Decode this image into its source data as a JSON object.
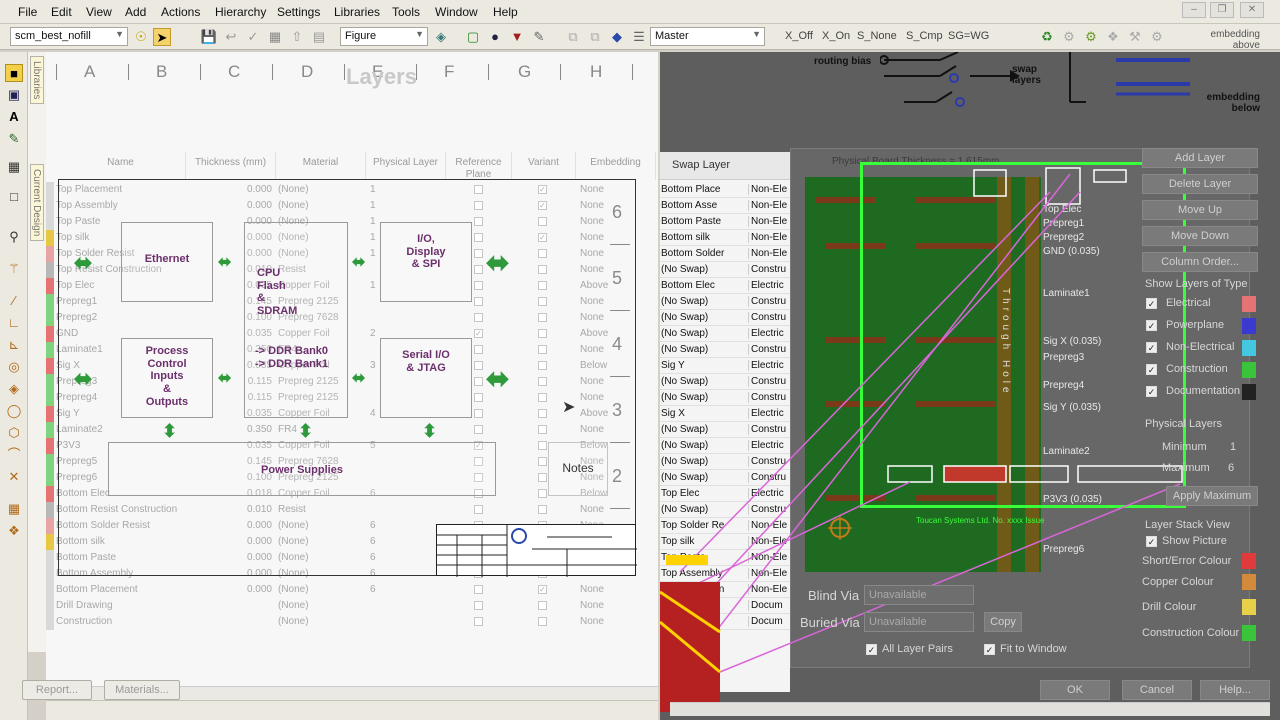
{
  "menu": {
    "items": [
      "File",
      "Edit",
      "View",
      "Add",
      "Actions",
      "Hierarchy",
      "Settings",
      "Libraries",
      "Tools",
      "Window",
      "Help"
    ]
  },
  "toolbar": {
    "style_combo": "scm_best_nofill",
    "mode_combo": "Figure",
    "variant_combo": "Master",
    "switches": [
      "X_Off",
      "X_On",
      "S_None",
      "S_Cmp",
      "SG=WG"
    ],
    "embedding_above": "embedding above"
  },
  "side_tabs": [
    "Libraries",
    "Current Design"
  ],
  "design": {
    "column_letters": [
      "A",
      "B",
      "C",
      "D",
      "E",
      "F",
      "G",
      "H"
    ],
    "overlay_title": "Layers",
    "row_digits": [
      "6",
      "5",
      "4",
      "3",
      "2",
      "1"
    ],
    "table": {
      "headers": [
        "Name",
        "Thickness (mm)",
        "Material",
        "Physical Layer",
        "Reference Plane",
        "Variant",
        "Embedding"
      ],
      "rows": [
        {
          "name": "Top Placement",
          "thk": "0.000",
          "mat": "(None)",
          "phys": "1",
          "ref": false,
          "var": true,
          "emb": "None",
          "color": "#d9d9d9"
        },
        {
          "name": "Top Assembly",
          "thk": "0.000",
          "mat": "(None)",
          "phys": "1",
          "ref": false,
          "var": true,
          "emb": "None",
          "color": "#d9d9d9"
        },
        {
          "name": "Top Paste",
          "thk": "0.000",
          "mat": "(None)",
          "phys": "1",
          "ref": false,
          "var": false,
          "emb": "None",
          "color": "#d9d9d9"
        },
        {
          "name": "Top silk",
          "thk": "0.000",
          "mat": "(None)",
          "phys": "1",
          "ref": false,
          "var": true,
          "emb": "None",
          "color": "#e6c845"
        },
        {
          "name": "Top Solder Resist",
          "thk": "0.000",
          "mat": "(None)",
          "phys": "1",
          "ref": false,
          "var": false,
          "emb": "None",
          "color": "#e8a3a3"
        },
        {
          "name": "Top Resist Construction",
          "thk": "0.010",
          "mat": "Resist",
          "phys": "",
          "ref": false,
          "var": false,
          "emb": "None",
          "color": "#b7b7b7"
        },
        {
          "name": "Top Elec",
          "thk": "0.035",
          "mat": "Copper Foil",
          "phys": "1",
          "ref": false,
          "var": false,
          "emb": "Above",
          "color": "#e57373"
        },
        {
          "name": "Prepreg1",
          "thk": "0.145",
          "mat": "Prepreg 2125",
          "phys": "",
          "ref": false,
          "var": false,
          "emb": "None",
          "color": "#7fd37f"
        },
        {
          "name": "Prepreg2",
          "thk": "0.100",
          "mat": "Prepreg 7628",
          "phys": "",
          "ref": false,
          "var": false,
          "emb": "None",
          "color": "#7fd37f"
        },
        {
          "name": "GND",
          "thk": "0.035",
          "mat": "Copper Foil",
          "phys": "2",
          "ref": true,
          "var": false,
          "emb": "Above",
          "color": "#e57373"
        },
        {
          "name": "Laminate1",
          "thk": "0.350",
          "mat": "FR4",
          "phys": "",
          "ref": false,
          "var": false,
          "emb": "None",
          "color": "#7fd37f"
        },
        {
          "name": "Sig X",
          "thk": "0.035",
          "mat": "Copper Foil",
          "phys": "3",
          "ref": false,
          "var": false,
          "emb": "Below",
          "color": "#e57373"
        },
        {
          "name": "Prepreg3",
          "thk": "0.115",
          "mat": "Prepreg 2125",
          "phys": "",
          "ref": false,
          "var": false,
          "emb": "None",
          "color": "#7fd37f"
        },
        {
          "name": "Prepreg4",
          "thk": "0.115",
          "mat": "Prepreg 2125",
          "phys": "",
          "ref": false,
          "var": false,
          "emb": "None",
          "color": "#7fd37f"
        },
        {
          "name": "Sig Y",
          "thk": "0.035",
          "mat": "Copper Foil",
          "phys": "4",
          "ref": false,
          "var": false,
          "emb": "Above",
          "color": "#e57373"
        },
        {
          "name": "Laminate2",
          "thk": "0.350",
          "mat": "FR4",
          "phys": "",
          "ref": false,
          "var": false,
          "emb": "None",
          "color": "#7fd37f"
        },
        {
          "name": "P3V3",
          "thk": "0.035",
          "mat": "Copper Foil",
          "phys": "5",
          "ref": true,
          "var": false,
          "emb": "Below",
          "color": "#e57373"
        },
        {
          "name": "Prepreg5",
          "thk": "0.145",
          "mat": "Prepreg 7628",
          "phys": "",
          "ref": false,
          "var": false,
          "emb": "None",
          "color": "#7fd37f"
        },
        {
          "name": "Prepreg6",
          "thk": "0.100",
          "mat": "Prepreg 2125",
          "phys": "",
          "ref": false,
          "var": false,
          "emb": "None",
          "color": "#7fd37f"
        },
        {
          "name": "Bottom Elec",
          "thk": "0.018",
          "mat": "Copper Foil",
          "phys": "6",
          "ref": false,
          "var": false,
          "emb": "Below",
          "color": "#e57373"
        },
        {
          "name": "Bottom Resist Construction",
          "thk": "0.010",
          "mat": "Resist",
          "phys": "",
          "ref": false,
          "var": false,
          "emb": "None",
          "color": "#b7b7b7"
        },
        {
          "name": "Bottom Solder Resist",
          "thk": "0.000",
          "mat": "(None)",
          "phys": "6",
          "ref": false,
          "var": false,
          "emb": "None",
          "color": "#e8a3a3"
        },
        {
          "name": "Bottom silk",
          "thk": "0.000",
          "mat": "(None)",
          "phys": "6",
          "ref": false,
          "var": false,
          "emb": "None",
          "color": "#e6c845"
        },
        {
          "name": "Bottom Paste",
          "thk": "0.000",
          "mat": "(None)",
          "phys": "6",
          "ref": false,
          "var": false,
          "emb": "None",
          "color": "#d9d9d9"
        },
        {
          "name": "Bottom Assembly",
          "thk": "0.000",
          "mat": "(None)",
          "phys": "6",
          "ref": false,
          "var": false,
          "emb": "None",
          "color": "#d9d9d9"
        },
        {
          "name": "Bottom Placement",
          "thk": "0.000",
          "mat": "(None)",
          "phys": "6",
          "ref": false,
          "var": true,
          "emb": "None",
          "color": "#d9d9d9"
        },
        {
          "name": "Drill Drawing",
          "thk": "",
          "mat": "(None)",
          "phys": "",
          "ref": false,
          "var": false,
          "emb": "None",
          "color": "#d9d9d9"
        },
        {
          "name": "Construction",
          "thk": "",
          "mat": "(None)",
          "phys": "",
          "ref": false,
          "var": false,
          "emb": "None",
          "color": "#d9d9d9"
        }
      ]
    },
    "blocks": {
      "ethernet": "Ethernet",
      "cpu": [
        "CPU",
        "Flash",
        "&",
        "SDRAM"
      ],
      "ddr": [
        "-> DDR Bank0",
        "-> DDR Bank1"
      ],
      "io_display": [
        "I/O,",
        "Display",
        "& SPI"
      ],
      "process_control": [
        "Process",
        "Control",
        "Inputs",
        "&",
        "Outputs"
      ],
      "serial_io": [
        "Serial I/O",
        "& JTAG"
      ],
      "power": "Power Supplies",
      "notes": "Notes"
    },
    "buttons": {
      "report": "Report...",
      "materials": "Materials..."
    }
  },
  "right": {
    "legend": {
      "routing_bias": "routing bias",
      "swap_layers": "swap layers",
      "embedding_below": "embedding below"
    },
    "swap_header": "Swap Layer",
    "swap_rows": [
      [
        "Bottom Place",
        "Non-Ele"
      ],
      [
        "Bottom Asse",
        "Non-Ele"
      ],
      [
        "Bottom Paste",
        "Non-Ele"
      ],
      [
        "Bottom silk",
        "Non-Ele"
      ],
      [
        "Bottom Solder",
        "Non-Ele"
      ],
      [
        "(No Swap)",
        "Constru"
      ],
      [
        "Bottom Elec",
        "Electric"
      ],
      [
        "(No Swap)",
        "Constru"
      ],
      [
        "(No Swap)",
        "Constru"
      ],
      [
        "(No Swap)",
        "Electric"
      ],
      [
        "(No Swap)",
        "Constru"
      ],
      [
        "Sig Y",
        "Electric"
      ],
      [
        "(No Swap)",
        "Constru"
      ],
      [
        "(No Swap)",
        "Constru"
      ],
      [
        "Sig X",
        "Electric"
      ],
      [
        "(No Swap)",
        "Constru"
      ],
      [
        "(No Swap)",
        "Electric"
      ],
      [
        "(No Swap)",
        "Constru"
      ],
      [
        "(No Swap)",
        "Constru"
      ],
      [
        "Top Elec",
        "Electric"
      ],
      [
        "(No Swap)",
        "Constru"
      ],
      [
        "Top Solder Re",
        "Non-Ele"
      ],
      [
        "Top silk",
        "Non-Ele"
      ],
      [
        "Top Paste",
        "Non-Ele"
      ],
      [
        "Top Assembly",
        "Non-Ele"
      ],
      [
        "Top Placemen",
        "Non-Ele"
      ],
      [
        "(None)",
        "Docum"
      ],
      [
        "(None)",
        "Docum"
      ]
    ],
    "stack_labels": [
      "Top Elec",
      "Prepreg1",
      "Prepreg2",
      "GND (0.035)",
      "Laminate1",
      "Sig X (0.035)",
      "Prepreg3",
      "Prepreg4",
      "Sig Y (0.035)",
      "Laminate2",
      "P3V3 (0.035)",
      "Prepreg6"
    ],
    "board_thickness_label": "Physical Board Thickness = 1.615mm",
    "through_hole": "Through Hole",
    "footer_caption": "Toucan Systems Ltd. No. xxxx Issue",
    "buttons": [
      "Add Layer",
      "Delete Layer",
      "Move Up",
      "Move Down",
      "Column Order..."
    ],
    "show_layers_title": "Show Layers of Type",
    "show_layers": [
      {
        "label": "Electrical",
        "checked": true,
        "color": "#e57373"
      },
      {
        "label": "Powerplane",
        "checked": true,
        "color": "#3a3ad0"
      },
      {
        "label": "Non-Electrical",
        "checked": true,
        "color": "#44c8e0"
      },
      {
        "label": "Construction",
        "checked": true,
        "color": "#39c43c"
      },
      {
        "label": "Documentation",
        "checked": true,
        "color": "#222222"
      }
    ],
    "physical_layers": {
      "title": "Physical Layers",
      "minimum_label": "Minimum",
      "minimum": "1",
      "maximum_label": "Maximum",
      "maximum": "6",
      "apply": "Apply Maximum"
    },
    "layer_stack_view": {
      "title": "Layer Stack View",
      "show_picture": "Show Picture"
    },
    "colour_rows": [
      {
        "label": "Short/Error Colour",
        "color": "#e03a3a"
      },
      {
        "label": "Copper Colour",
        "color": "#d38a3a"
      },
      {
        "label": "Drill Colour",
        "color": "#e8d04a"
      },
      {
        "label": "Construction Colour",
        "color": "#39c43c"
      }
    ],
    "via": {
      "blind_label": "Blind Via",
      "blind_value": "Unavailable",
      "buried_label": "Buried Via",
      "buried_value": "Unavailable",
      "copy": "Copy"
    },
    "checks": {
      "all_layer_pairs": "All Layer Pairs",
      "fit_to_window": "Fit to Window"
    },
    "dialog_buttons": {
      "ok": "OK",
      "cancel": "Cancel",
      "help": "Help..."
    }
  }
}
